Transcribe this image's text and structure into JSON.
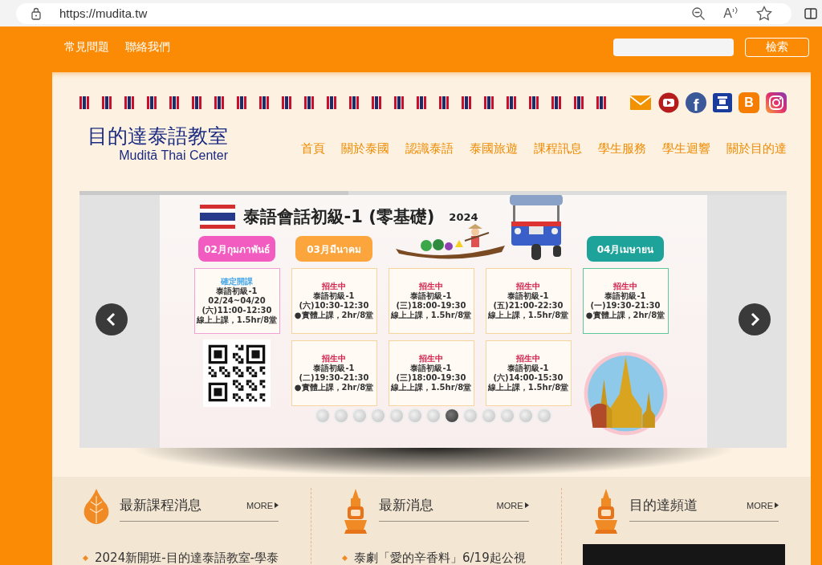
{
  "browser": {
    "url": "https://mudita.tw",
    "read_aloud_glyph": "A"
  },
  "top_links": [
    "常見問題",
    "聯絡我們"
  ],
  "search": {
    "button": "檢索"
  },
  "social": [
    {
      "kind": "mail"
    },
    {
      "kind": "video"
    },
    {
      "kind": "facebook",
      "glyph": "f"
    },
    {
      "kind": "building"
    },
    {
      "kind": "blog",
      "glyph": "B"
    },
    {
      "kind": "camera"
    }
  ],
  "logo": {
    "title": "目的達泰語教室",
    "subtitle": "Muditā Thai Center"
  },
  "nav": [
    "首頁",
    "關於泰國",
    "認識泰語",
    "泰國旅遊",
    "課程訊息",
    "學生服務",
    "學生迴響",
    "關於目的達"
  ],
  "carousel": {
    "level": 0.38,
    "slide": {
      "title": "泰語會話初級-1 (零基礎)",
      "year": "2024",
      "months": [
        {
          "label": "02月กุมภาพันธ์",
          "color": "#f25cc0"
        },
        {
          "label": "03月มีนาคม",
          "color": "#fba53c"
        },
        {
          "label": "04月เมษายน",
          "color": "#1ea39a"
        }
      ],
      "cards": [
        {
          "status": "確定開課",
          "kind": "confirmed",
          "course": "泰語初級-1",
          "dates": "02/24~04/20",
          "time": "(六)11:00-12:30",
          "mode": "線上上課，1.5hr/8堂",
          "color": "#f2a0d8"
        },
        {
          "status": "招生中",
          "kind": "enrolling",
          "course": "泰語初級-1",
          "time": "(六)10:30-12:30",
          "mode": "●實體上課，2hr/8堂",
          "color": "#f5d49e"
        },
        {
          "status": "招生中",
          "kind": "enrolling",
          "course": "泰語初級-1",
          "time": "(三)18:00-19:30",
          "mode": "線上上課，1.5hr/8堂",
          "color": "#f5d49e"
        },
        {
          "status": "招生中",
          "kind": "enrolling",
          "course": "泰語初級-1",
          "time": "(五)21:00-22:30",
          "mode": "線上上課，1.5hr/8堂",
          "color": "#f5d49e"
        },
        {
          "status": "招生中",
          "kind": "enrolling",
          "course": "泰語初級-1",
          "time": "(一)19:30-21:30",
          "mode": "●實體上課，2hr/8堂",
          "color": "#5cc79a"
        },
        {
          "status": "招生中",
          "kind": "enrolling",
          "course": "泰語初級-1",
          "time": "(二)19:30-21:30",
          "mode": "●實體上課，2hr/8堂",
          "color": "#f5d49e"
        },
        {
          "status": "招生中",
          "kind": "enrolling",
          "course": "泰語初級-1",
          "time": "(三)18:00-19:30",
          "mode": "線上上課，1.5hr/8堂",
          "color": "#f5d49e"
        },
        {
          "status": "招生中",
          "kind": "enrolling",
          "course": "泰語初級-1",
          "time": "(六)14:00-15:30",
          "mode": "線上上課，1.5hr/8堂",
          "color": "#f5d49e"
        }
      ]
    },
    "dots": [
      {
        "selected": false
      },
      {
        "selected": false
      },
      {
        "selected": false
      },
      {
        "selected": false
      },
      {
        "selected": false
      },
      {
        "selected": false
      },
      {
        "selected": false
      },
      {
        "selected": true
      },
      {
        "selected": false
      },
      {
        "selected": false
      },
      {
        "selected": false
      },
      {
        "selected": false
      },
      {
        "selected": false
      }
    ]
  },
  "sections": [
    {
      "title": "最新課程消息",
      "more": "MORE",
      "kind": "list",
      "items": [
        "2024新開班-目的達泰語教室-學泰"
      ]
    },
    {
      "title": "最新消息",
      "more": "MORE",
      "kind": "list",
      "items": [
        "泰劇「愛的辛香料」6/19起公視"
      ]
    },
    {
      "title": "目的達頻道",
      "more": "MORE",
      "kind": "video"
    }
  ]
}
